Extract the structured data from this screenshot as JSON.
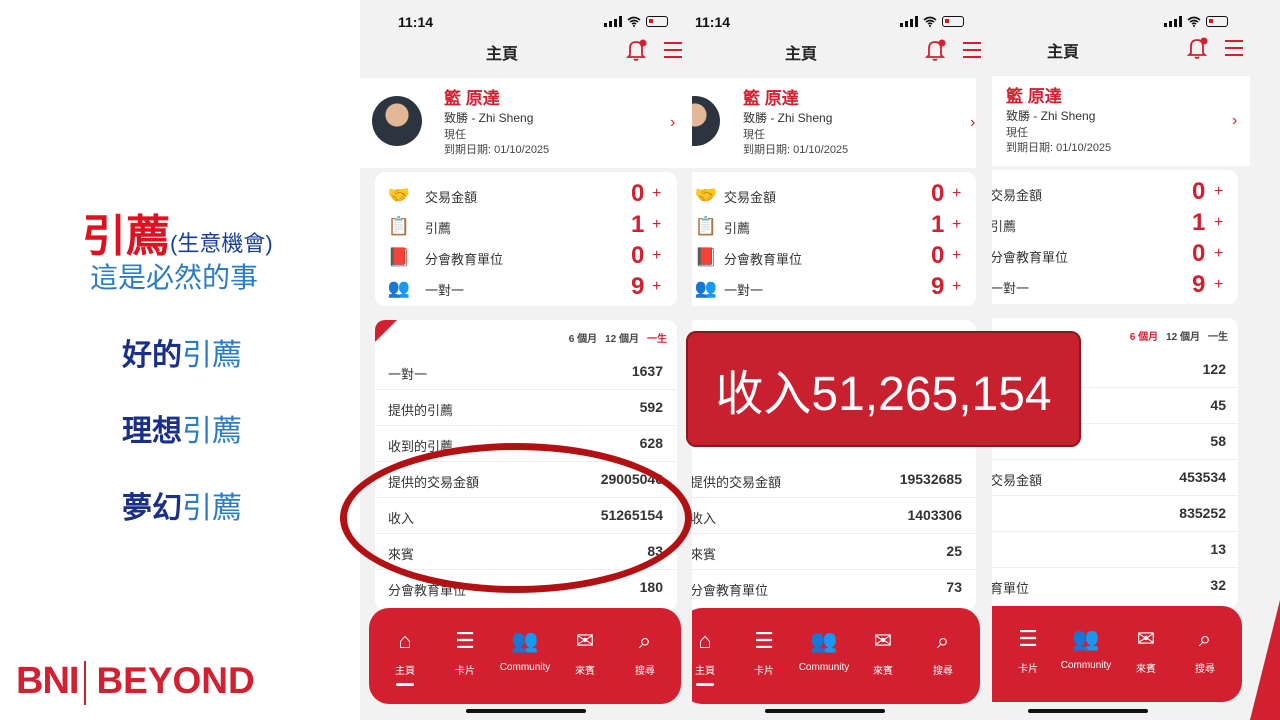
{
  "left": {
    "title_big": "引薦",
    "title_paren": "(生意機會)",
    "subtitle": "這是必然的事",
    "items": [
      {
        "bold": "好的",
        "normal": "引薦"
      },
      {
        "bold": "理想",
        "normal": "引薦"
      },
      {
        "bold": "夢幻",
        "normal": "引薦"
      }
    ],
    "logo_left": "BNI",
    "logo_right": "BEYOND"
  },
  "callout": "收入51,265,154",
  "phones": [
    {
      "time": "11:14",
      "header_title": "主頁",
      "profile": {
        "name": "籃 原達",
        "company": "致勝 - Zhi Sheng",
        "status": "現任",
        "expiry": "到期日期: 01/10/2025"
      },
      "stats": [
        {
          "icon": "handshake-icon",
          "label": "交易金額",
          "value": "0",
          "plus": "+"
        },
        {
          "icon": "referral-icon",
          "label": "引薦",
          "value": "1",
          "plus": "+"
        },
        {
          "icon": "book-icon",
          "label": "分會教育單位",
          "value": "0",
          "plus": "+"
        },
        {
          "icon": "one-to-one-icon",
          "label": "一對一",
          "value": "9",
          "plus": "+"
        }
      ],
      "tabs": [
        "6 個月",
        "12 個月",
        "一生"
      ],
      "active_tab": 2,
      "rows": [
        {
          "label": "一對一",
          "value": "1637"
        },
        {
          "label": "提供的引薦",
          "value": "592"
        },
        {
          "label": "收到的引薦",
          "value": "628"
        },
        {
          "label": "提供的交易金額",
          "value": "29005046"
        },
        {
          "label": "收入",
          "value": "51265154"
        },
        {
          "label": "來賓",
          "value": "83"
        },
        {
          "label": "分會教育單位",
          "value": "180"
        }
      ],
      "nav": [
        {
          "icon": "home-icon",
          "label": "主頁"
        },
        {
          "icon": "card-icon",
          "label": "卡片"
        },
        {
          "icon": "community-icon",
          "label": "Community"
        },
        {
          "icon": "guest-icon",
          "label": "來賓"
        },
        {
          "icon": "search-icon",
          "label": "搜尋"
        }
      ]
    },
    {
      "time": "11:14",
      "header_title": "主頁",
      "profile": {
        "name": "籃 原達",
        "company": "致勝 - Zhi Sheng",
        "status": "現任",
        "expiry": "到期日期: 01/10/2025"
      },
      "stats": [
        {
          "icon": "handshake-icon",
          "label": "交易金額",
          "value": "0",
          "plus": "+"
        },
        {
          "icon": "referral-icon",
          "label": "引薦",
          "value": "1",
          "plus": "+"
        },
        {
          "icon": "book-icon",
          "label": "分會教育單位",
          "value": "0",
          "plus": "+"
        },
        {
          "icon": "one-to-one-icon",
          "label": "一對一",
          "value": "9",
          "plus": "+"
        }
      ],
      "rows": [
        {
          "label": "提供的交易金額",
          "value": "19532685"
        },
        {
          "label": "收入",
          "value": "1403306"
        },
        {
          "label": "來賓",
          "value": "25"
        },
        {
          "label": "分會教育單位",
          "value": "73"
        }
      ],
      "nav": [
        {
          "icon": "home-icon",
          "label": "主頁"
        },
        {
          "icon": "card-icon",
          "label": "卡片"
        },
        {
          "icon": "community-icon",
          "label": "Community"
        },
        {
          "icon": "guest-icon",
          "label": "來賓"
        },
        {
          "icon": "search-icon",
          "label": "搜尋"
        }
      ]
    },
    {
      "header_title": "主頁",
      "profile": {
        "name": "籃 原達",
        "company": "致勝 - Zhi Sheng",
        "status": "現任",
        "expiry": "到期日期: 01/10/2025"
      },
      "stats": [
        {
          "icon": "",
          "label": "交易金額",
          "value": "0",
          "plus": "+"
        },
        {
          "icon": "",
          "label": "引薦",
          "value": "1",
          "plus": "+"
        },
        {
          "icon": "",
          "label": "分會教育單位",
          "value": "0",
          "plus": "+"
        },
        {
          "icon": "",
          "label": "一對一",
          "value": "9",
          "plus": "+"
        }
      ],
      "tabs": [
        "6 個月",
        "12 個月",
        "一生"
      ],
      "active_tab": 0,
      "rows": [
        {
          "label": "",
          "value": "122"
        },
        {
          "label": "",
          "value": "45"
        },
        {
          "label": "",
          "value": "58"
        },
        {
          "label": "交易金額",
          "value": "453534"
        },
        {
          "label": "",
          "value": "835252"
        },
        {
          "label": "",
          "value": "13"
        },
        {
          "label": "育單位",
          "value": "32"
        }
      ],
      "nav": [
        {
          "icon": "card-icon",
          "label": "卡片"
        },
        {
          "icon": "community-icon",
          "label": "Community"
        },
        {
          "icon": "guest-icon",
          "label": "來賓"
        },
        {
          "icon": "search-icon",
          "label": "搜尋"
        }
      ]
    }
  ]
}
